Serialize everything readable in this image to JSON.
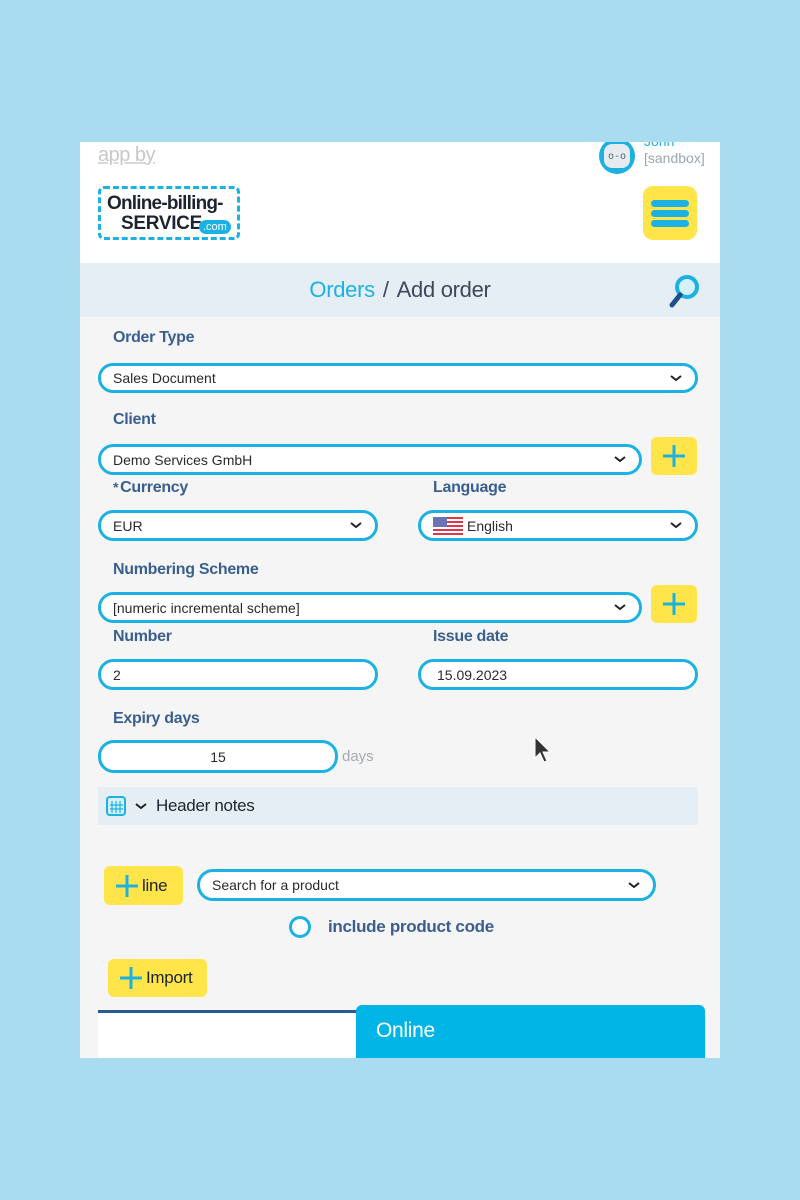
{
  "header": {
    "app_by": "app by",
    "logo": {
      "line1": "Online-billing-",
      "line2": "service",
      "tld": ".com"
    },
    "user": {
      "name": "John",
      "env": "[sandbox]",
      "avatar_icon": "user-avatar-icon"
    },
    "menu_icon": "hamburger-menu-icon"
  },
  "breadcrumb": {
    "items": [
      "Orders",
      "Add order"
    ],
    "separator": "/",
    "search_icon": "search-icon"
  },
  "form": {
    "order_type": {
      "label": "Order Type",
      "value": "Sales Document"
    },
    "client": {
      "label": "Client",
      "value": "Demo Services GmbH"
    },
    "currency": {
      "required_mark": "*",
      "label": "Currency",
      "value": "EUR"
    },
    "language": {
      "label": "Language",
      "value": "English",
      "flag": "us-flag-icon"
    },
    "numbering_scheme": {
      "label": "Numbering Scheme",
      "value": "[numeric incremental scheme]"
    },
    "number": {
      "label": "Number",
      "value": "2"
    },
    "issue_date": {
      "label": "Issue date",
      "value": "15.09.2023"
    },
    "expiry_days": {
      "label": "Expiry days",
      "value": "15",
      "unit": "days"
    },
    "header_notes": {
      "label": "Header notes"
    }
  },
  "lines": {
    "add_line_label": "line",
    "product_search_placeholder": "Search for a product",
    "include_product_code_label": "include product code",
    "include_product_code_checked": false,
    "import_label": "Import"
  },
  "chat": {
    "title": "Online"
  },
  "colors": {
    "accent": "#1bb2e3",
    "button_yellow": "#ffe54a",
    "label_blue": "#3a5f8f",
    "chat_blue": "#00b5e6",
    "background": "#a9dcf1"
  }
}
